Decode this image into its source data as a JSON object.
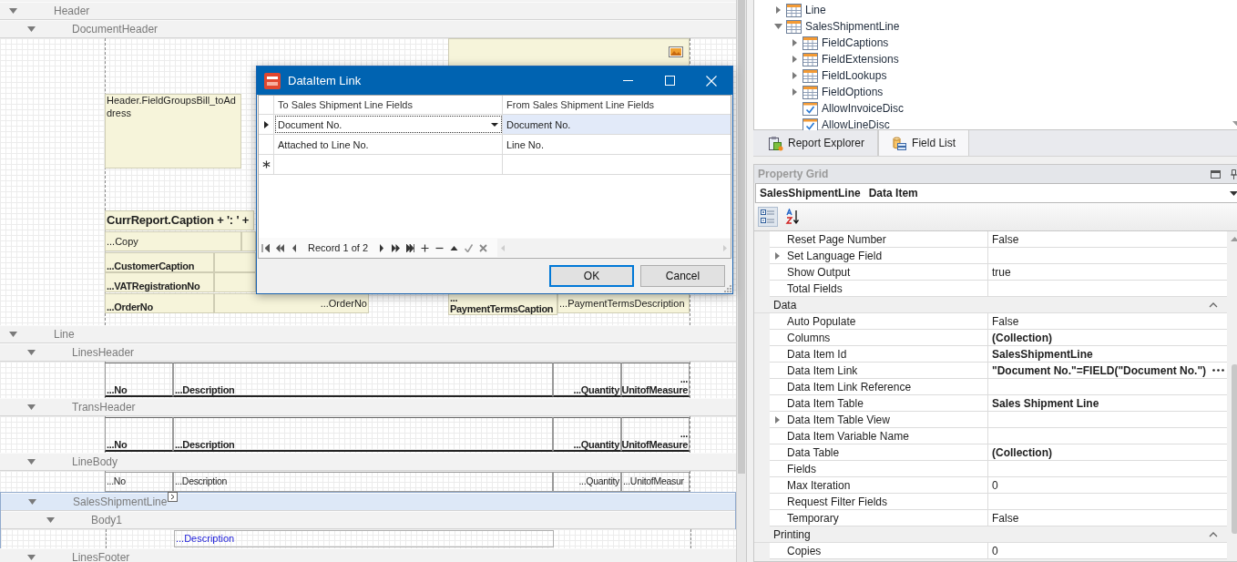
{
  "designer": {
    "bands": [
      {
        "title": "Header",
        "selected": false,
        "children": [
          {
            "title": "DocumentHeader",
            "selected": false,
            "controls": [
              {
                "kind": "image"
              },
              {
                "kind": "field",
                "text": "Header.FieldGroupsBill_toAddress"
              },
              {
                "kind": "title",
                "text": "CurrReport.Caption + ': ' +"
              },
              {
                "kind": "field",
                "text": "...Copy"
              },
              {
                "kind": "blank"
              },
              {
                "kind": "caption",
                "text": "...CustomerCaption"
              },
              {
                "kind": "blank"
              },
              {
                "kind": "caption",
                "text": "...VATRegistrationNo"
              },
              {
                "kind": "blank"
              },
              {
                "kind": "caption",
                "text": "...OrderNo"
              },
              {
                "kind": "field",
                "text": "...OrderNo"
              },
              {
                "kind": "caption",
                "text": "...PaymentTermsCaption"
              },
              {
                "kind": "field",
                "text": "...PaymentTermsDescription"
              }
            ]
          }
        ]
      },
      {
        "title": "Line",
        "selected": false,
        "children": [
          {
            "title": "LinesHeader",
            "selected": false,
            "controls": [
              {
                "kind": "header",
                "text": "...No"
              },
              {
                "kind": "header",
                "text": "...Description"
              },
              {
                "kind": "header",
                "text": "...Quantity"
              },
              {
                "kind": "header",
                "text": "...UnitofMeasure"
              }
            ]
          },
          {
            "title": "TransHeader",
            "selected": false,
            "controls": [
              {
                "kind": "header",
                "text": "...No"
              },
              {
                "kind": "header",
                "text": "...Description"
              },
              {
                "kind": "header",
                "text": "...Quantity"
              },
              {
                "kind": "header",
                "text": "...UnitofMeasure"
              }
            ]
          },
          {
            "title": "LineBody",
            "selected": false,
            "controls": [
              {
                "kind": "cell",
                "text": "...No"
              },
              {
                "kind": "cell",
                "text": "...Description"
              },
              {
                "kind": "cell",
                "text": "...Quantity"
              },
              {
                "kind": "cell",
                "text": "...UnitofMeasur"
              }
            ]
          },
          {
            "title": "SalesShipmentLine",
            "selected": true,
            "children": [
              {
                "title": "Body1",
                "selected": false,
                "controls": [
                  {
                    "kind": "expression",
                    "text": "...Description"
                  }
                ]
              }
            ]
          },
          {
            "title": "LinesFooter",
            "selected": false
          }
        ]
      }
    ]
  },
  "dialog": {
    "title": "DataItem Link",
    "columns": [
      "To Sales Shipment Line Fields",
      "From Sales Shipment Line Fields"
    ],
    "rows": [
      {
        "to": "Document No.",
        "from": "Document No.",
        "selected": true
      },
      {
        "to": "Attached to Line No.",
        "from": "Line No.",
        "selected": false
      }
    ],
    "record_counter": "Record 1 of 2",
    "buttons": [
      {
        "label": "OK",
        "default": true
      },
      {
        "label": "Cancel",
        "default": false
      }
    ]
  },
  "field_list": {
    "items": [
      {
        "label": "Line",
        "kind": "table",
        "expanded": false
      },
      {
        "label": "SalesShipmentLine",
        "kind": "table",
        "expanded": true,
        "children": [
          {
            "label": "FieldCaptions",
            "kind": "table",
            "expanded": false
          },
          {
            "label": "FieldExtensions",
            "kind": "table",
            "expanded": false
          },
          {
            "label": "FieldLookups",
            "kind": "table",
            "expanded": false
          },
          {
            "label": "FieldOptions",
            "kind": "table",
            "expanded": false
          },
          {
            "label": "AllowInvoiceDisc",
            "kind": "boolean"
          },
          {
            "label": "AllowLineDisc",
            "kind": "boolean"
          }
        ]
      }
    ]
  },
  "panel_tabs": [
    {
      "label": "Report Explorer",
      "kind": "explorer",
      "selected": false
    },
    {
      "label": "Field List",
      "kind": "fields",
      "selected": true
    }
  ],
  "property_grid": {
    "title": "Property Grid",
    "object_name": "SalesShipmentLine",
    "object_type": "Data Item",
    "toolbar": [
      {
        "kind": "categorized",
        "selected": true
      },
      {
        "kind": "alphabetical",
        "selected": false
      }
    ],
    "sections": [
      {
        "rows": [
          {
            "name": "Reset Page Number",
            "value": "False",
            "modified": false,
            "expandable": false
          },
          {
            "name": "Set Language Field",
            "modified": false,
            "expandable": true
          },
          {
            "name": "Show Output",
            "value": "true",
            "modified": false,
            "expandable": false
          },
          {
            "name": "Total Fields",
            "modified": false,
            "expandable": false
          }
        ]
      },
      {
        "title": "Data",
        "expanded": true,
        "rows": [
          {
            "name": "Auto Populate",
            "value": "False",
            "modified": false,
            "expandable": false
          },
          {
            "name": "Columns",
            "value": "(Collection)",
            "modified": true,
            "expandable": false
          },
          {
            "name": "Data Item Id",
            "value": "SalesShipmentLine",
            "modified": true,
            "expandable": false
          },
          {
            "name": "Data Item Link",
            "value": "\"Document No.\"=FIELD(\"Document No.\")",
            "modified": true,
            "expandable": false,
            "has_editor_button": true
          },
          {
            "name": "Data Item Link Reference",
            "modified": false,
            "expandable": false
          },
          {
            "name": "Data Item Table",
            "value": "Sales Shipment Line",
            "modified": true,
            "expandable": false
          },
          {
            "name": "Data Item Table View",
            "modified": false,
            "expandable": true
          },
          {
            "name": "Data Item Variable Name",
            "modified": false,
            "expandable": false
          },
          {
            "name": "Data Table",
            "value": "(Collection)",
            "modified": true,
            "expandable": false
          },
          {
            "name": "Fields",
            "modified": false,
            "expandable": false
          },
          {
            "name": "Max Iteration",
            "value": "0",
            "modified": false,
            "expandable": false
          },
          {
            "name": "Request Filter Fields",
            "modified": false,
            "expandable": false
          },
          {
            "name": "Temporary",
            "value": "False",
            "modified": false,
            "expandable": false
          }
        ]
      },
      {
        "title": "Printing",
        "expanded": true,
        "rows": [
          {
            "name": "Copies",
            "value": "0",
            "modified": false,
            "expandable": false
          }
        ]
      }
    ]
  }
}
